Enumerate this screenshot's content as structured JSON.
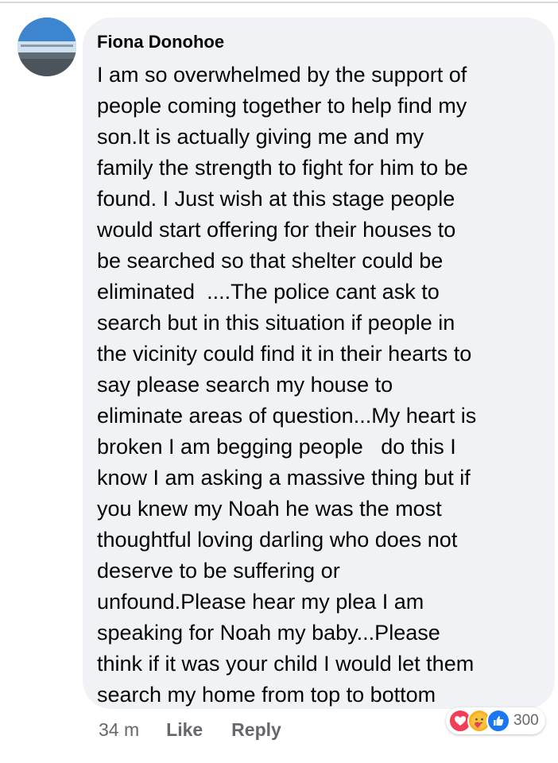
{
  "comment": {
    "author": "Fiona Donohoe",
    "lines": [
      "I am so overwhelmed by the support of",
      "people coming together to help find my",
      "son.It is actually giving me and my",
      "family the strength to fight for him to be",
      "found. I Just wish at this stage people",
      "would start offering for their houses to",
      "be searched so that shelter could be",
      "eliminated  ....The police cant ask to",
      "search but in this situation if people in",
      "the vicinity could find it in their hearts to",
      "say please search my house to",
      "eliminate areas of question...My heart is",
      "broken I am begging people   do this I",
      "know I am asking a massive thing but if",
      "you knew my Noah he was the most",
      "thoughtful loving darling who does not",
      "deserve to be suffering or",
      "unfound.Please hear my plea I am",
      "speaking for Noah my baby...Please",
      "think if it was your child I would let them",
      "search my home from top to bottom"
    ],
    "timestamp": "34 m",
    "like_label": "Like",
    "reply_label": "Reply",
    "reactions": {
      "icons": [
        "love-icon",
        "care-icon",
        "like-icon"
      ],
      "count": "300"
    }
  },
  "colors": {
    "bubble": "#f0f2f5",
    "text": "#050505",
    "secondary": "#65676b",
    "like_blue": "#1877f2",
    "love_red": "#f33e58",
    "care_yellow": "#f7b125"
  }
}
